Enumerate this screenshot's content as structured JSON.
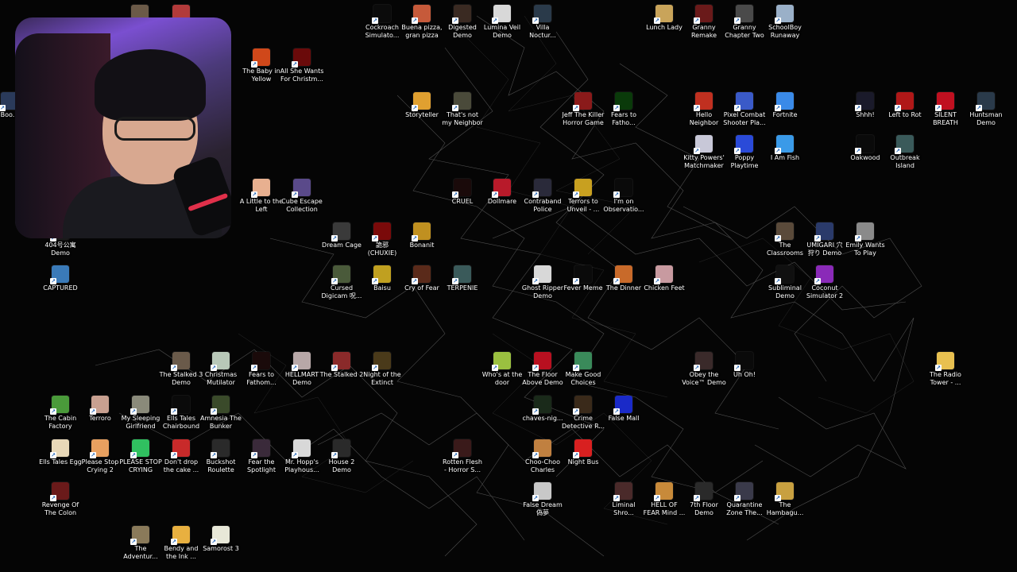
{
  "desktop": {
    "icons": [
      {
        "label": "",
        "color": "#6b5a48"
      },
      {
        "label": "",
        "color": "#b23a3a"
      },
      {
        "label": "Cockroach\nSimulato...",
        "color": "#0b0b0b"
      },
      {
        "label": "Buena pizza,\ngran pizza",
        "color": "#c65a3a"
      },
      {
        "label": "Digested\nDemo",
        "color": "#3a2a22"
      },
      {
        "label": "Lumina Veil\nDemo",
        "color": "#d8d8d8"
      },
      {
        "label": "Villa\nNoctur...",
        "color": "#2a3a4a"
      },
      {
        "label": "Lunch Lady",
        "color": "#c9a45a"
      },
      {
        "label": "Granny\nRemake",
        "color": "#6a1a1a"
      },
      {
        "label": "Granny\nChapter Two",
        "color": "#4a4a4a"
      },
      {
        "label": "SchoolBoy\nRunaway",
        "color": "#9ab0c8"
      },
      {
        "label": "The Baby in\nYellow",
        "color": "#d0481a"
      },
      {
        "label": "All She Wants\nFor Christm...",
        "color": "#6a0a0a"
      },
      {
        "label": "Boo...",
        "color": "#2a3a5a"
      },
      {
        "label": "Storyteller",
        "color": "#e0a030"
      },
      {
        "label": "That's not\nmy Neighbor",
        "color": "#4a4a3a"
      },
      {
        "label": "Jeff The Killer\nHorror Game",
        "color": "#8a1a1a"
      },
      {
        "label": "Fears to\nFatho...",
        "color": "#0a3a0a"
      },
      {
        "label": "Hello\nNeighbor",
        "color": "#c03020"
      },
      {
        "label": "Pixel Combat\nShooter Pla...",
        "color": "#3a5ac8"
      },
      {
        "label": "Fortnite",
        "color": "#3a8ae8"
      },
      {
        "label": "Shhh!",
        "color": "#1a1a2a"
      },
      {
        "label": "Left to Rot",
        "color": "#b01818"
      },
      {
        "label": "SILENT\nBREATH",
        "color": "#c01020"
      },
      {
        "label": "Huntsman\nDemo",
        "color": "#2a3a4a"
      },
      {
        "label": "Kitty Powers'\nMatchmaker",
        "color": "#c8c8d8"
      },
      {
        "label": "Poppy\nPlaytime",
        "color": "#2a4ad8"
      },
      {
        "label": "I Am Fish",
        "color": "#3a9ae8"
      },
      {
        "label": "Oakwood",
        "color": "#0a0a0a"
      },
      {
        "label": "Outbreak\nIsland",
        "color": "#3a5a5a"
      },
      {
        "label": "A Little to the\nLeft",
        "color": "#e8b090"
      },
      {
        "label": "Cube Escape\nCollection",
        "color": "#5a4a8a"
      },
      {
        "label": "CRUEL",
        "color": "#1a0a0a"
      },
      {
        "label": "Dollmare",
        "color": "#b81a2a"
      },
      {
        "label": "Contraband\nPolice",
        "color": "#2a2a3a"
      },
      {
        "label": "Terrors to\nUnveil - ...",
        "color": "#c8a020"
      },
      {
        "label": "I'm on\nObservatio...",
        "color": "#0a0a0a"
      },
      {
        "label": "The\nClassrooms",
        "color": "#5a4a3a"
      },
      {
        "label": "UMIGARI 穴\n狩り Demo",
        "color": "#2a3a6a"
      },
      {
        "label": "Emily Wants\nTo Play",
        "color": "#8a8a8a"
      },
      {
        "label": "404号公寓\nDemo",
        "color": "#1a1a1a"
      },
      {
        "label": "CAPTURED",
        "color": "#3a7ab8"
      },
      {
        "label": "Dream Cage",
        "color": "#3a3a3a"
      },
      {
        "label": "詭邪\n(CHUXIE)",
        "color": "#7a0a0a"
      },
      {
        "label": "Bonanit",
        "color": "#c09020"
      },
      {
        "label": "Cursed\nDigicam 呪...",
        "color": "#4a5a3a"
      },
      {
        "label": "Baisu",
        "color": "#c0a020"
      },
      {
        "label": "Cry of Fear",
        "color": "#5a2a1a"
      },
      {
        "label": "TERPENIE",
        "color": "#3a5a5a"
      },
      {
        "label": "Ghost Ripper\nDemo",
        "color": "#d8d8d8"
      },
      {
        "label": "Fever Meme",
        "color": "#0a0a0a"
      },
      {
        "label": "The Dinner",
        "color": "#c86a2a"
      },
      {
        "label": "Chicken Feet",
        "color": "#c89aa0"
      },
      {
        "label": "Subliminal\nDemo",
        "color": "#101010"
      },
      {
        "label": "Coconut\nSimulator 2",
        "color": "#8a2ab8"
      },
      {
        "label": "The Stalked 3\nDemo",
        "color": "#6a5a4a"
      },
      {
        "label": "Christmas\nMutilator",
        "color": "#b8c8b8"
      },
      {
        "label": "Fears to\nFathom...",
        "color": "#1a0a0a"
      },
      {
        "label": "HELLMART\nDemo",
        "color": "#b8a8a8"
      },
      {
        "label": "The Stalked 2",
        "color": "#8a2a2a"
      },
      {
        "label": "Night of the\nExtinct",
        "color": "#4a3a1a"
      },
      {
        "label": "Who's at the\ndoor",
        "color": "#9ac040"
      },
      {
        "label": "The Floor\nAbove Demo",
        "color": "#b81020"
      },
      {
        "label": "Make Good\nChoices",
        "color": "#3a8a5a"
      },
      {
        "label": "Obey the\nVoice™ Demo",
        "color": "#3a2a2a"
      },
      {
        "label": "Uh Oh!",
        "color": "#0a0a0a"
      },
      {
        "label": "The Radio\nTower - ...",
        "color": "#e8c050"
      },
      {
        "label": "The Cabin\nFactory",
        "color": "#4a9a3a"
      },
      {
        "label": "Terroro",
        "color": "#c8a090"
      },
      {
        "label": "My Sleeping\nGirlfriend",
        "color": "#8a8a7a"
      },
      {
        "label": "Ells Tales\nChairbound",
        "color": "#0a0a0a"
      },
      {
        "label": "Amnesia The\nBunker",
        "color": "#3a4a2a"
      },
      {
        "label": "chaves-nig...",
        "color": "#1a2a1a"
      },
      {
        "label": "Crime\nDetective R...",
        "color": "#3a2a1a"
      },
      {
        "label": "False Mall",
        "color": "#1a2ac8"
      },
      {
        "label": "Ells Tales Egg",
        "color": "#e8d8b8"
      },
      {
        "label": "Please Stop\nCrying 2",
        "color": "#e8a060"
      },
      {
        "label": "PLEASE STOP\nCRYING",
        "color": "#30c060"
      },
      {
        "label": "Don't drop\nthe cake ...",
        "color": "#c82a2a"
      },
      {
        "label": "Buckshot\nRoulette",
        "color": "#2a2a2a"
      },
      {
        "label": "Fear the\nSpotlight",
        "color": "#3a2a3a"
      },
      {
        "label": "Mr. Hopp's\nPlayhous...",
        "color": "#d8d8d8"
      },
      {
        "label": "House 2\nDemo",
        "color": "#2a2a2a"
      },
      {
        "label": "Rotten Flesh\n- Horror S...",
        "color": "#3a1a1a"
      },
      {
        "label": "Choo-Choo\nCharles",
        "color": "#c08040"
      },
      {
        "label": "Night Bus",
        "color": "#d82020"
      },
      {
        "label": "Revenge Of\nThe Colon",
        "color": "#6a1a1a"
      },
      {
        "label": "False Dream\n偽夢",
        "color": "#c8c8c8"
      },
      {
        "label": "Liminal\nShro...",
        "color": "#4a2a2a"
      },
      {
        "label": "HELL OF\nFEAR Mind ...",
        "color": "#c88a3a"
      },
      {
        "label": "7th Floor\nDemo",
        "color": "#2a2a2a"
      },
      {
        "label": "Quarantine\nZone The...",
        "color": "#3a3a4a"
      },
      {
        "label": "The\nHambagu...",
        "color": "#c8a040"
      },
      {
        "label": "The\nAdventur...",
        "color": "#8a7a5a"
      },
      {
        "label": "Bendy and\nthe Ink ...",
        "color": "#e8b040"
      },
      {
        "label": "Samorost 3",
        "color": "#e8e8d8"
      }
    ]
  }
}
